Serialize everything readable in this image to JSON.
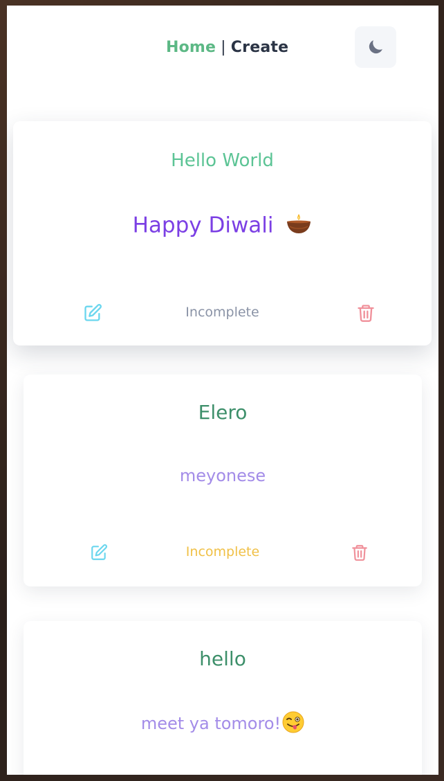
{
  "nav": {
    "home_label": "Home",
    "separator": "|",
    "create_label": "Create",
    "theme_toggle_icon": "moon-icon"
  },
  "colors": {
    "brand_green": "#5cb885",
    "title_green": "#3d8f6a",
    "violet": "#7b3fe4",
    "lavender": "#a38ce8",
    "status_gray": "#8a93a6",
    "status_yellow": "#f0c046",
    "edit_cyan": "#6ad6ee",
    "delete_pink": "#f0909a"
  },
  "notes": [
    {
      "title": "Hello World",
      "body": "Happy Diwali",
      "body_emoji": "diya-lamp-emoji",
      "status": "Incomplete",
      "edit_icon": "edit-icon",
      "delete_icon": "trash-icon"
    },
    {
      "title": "Elero",
      "body": "meyonese",
      "status": "Incomplete",
      "edit_icon": "edit-icon",
      "delete_icon": "trash-icon"
    },
    {
      "title": "hello",
      "body": "meet ya tomoro!",
      "body_emoji": "winking-face-with-tongue-emoji"
    }
  ]
}
